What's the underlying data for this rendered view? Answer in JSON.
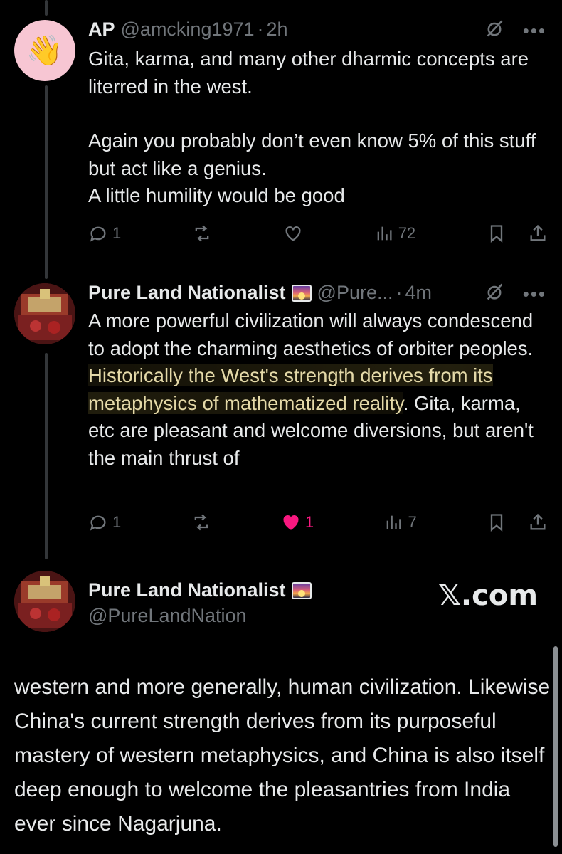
{
  "post1": {
    "name": "AP",
    "handle": "@amcking1971",
    "sep": "·",
    "time": "2h",
    "avatar_emoji": "👋",
    "body": "Gita, karma, and many other dharmic concepts are literred in the west.",
    "body2": "Again you probably don’t even know 5% of this stuff but act like a genius.",
    "body3": "A little humility would be good",
    "replies": "1",
    "reposts": "",
    "likes": "",
    "views": "72"
  },
  "post2": {
    "name": "Pure Land Nationalist",
    "handle": "@Pure...",
    "sep": "·",
    "time": "4m",
    "body_a": "A more powerful civilization will always condescend to adopt the charming aesthetics of orbiter peoples. ",
    "body_highlight": "Historically the West's strength derives from its metaphysics of mathematized reality",
    "body_b": ". Gita, karma, etc are pleasant and welcome diversions, but aren't the main thrust of",
    "replies": "1",
    "reposts": "",
    "likes": "1",
    "views": "7"
  },
  "post3": {
    "name": "Pure Land Nationalist",
    "handle": "@PureLandNation",
    "watermark": "𝕏.com",
    "body": "western and more generally, human civilization. Likewise China's current strength derives from its purposeful mastery of western metaphysics, and China is also itself deep enough to welcome the pleasantries from India ever since Nagarjuna."
  },
  "colors": {
    "background": "#000000",
    "text": "#e7e9ea",
    "muted": "#71767b",
    "like": "#f91880",
    "highlight_text": "#e4d9a8"
  },
  "icons": [
    "reply-icon",
    "repost-icon",
    "like-icon",
    "views-icon",
    "bookmark-icon",
    "share-icon",
    "grok-icon",
    "more-icon"
  ]
}
